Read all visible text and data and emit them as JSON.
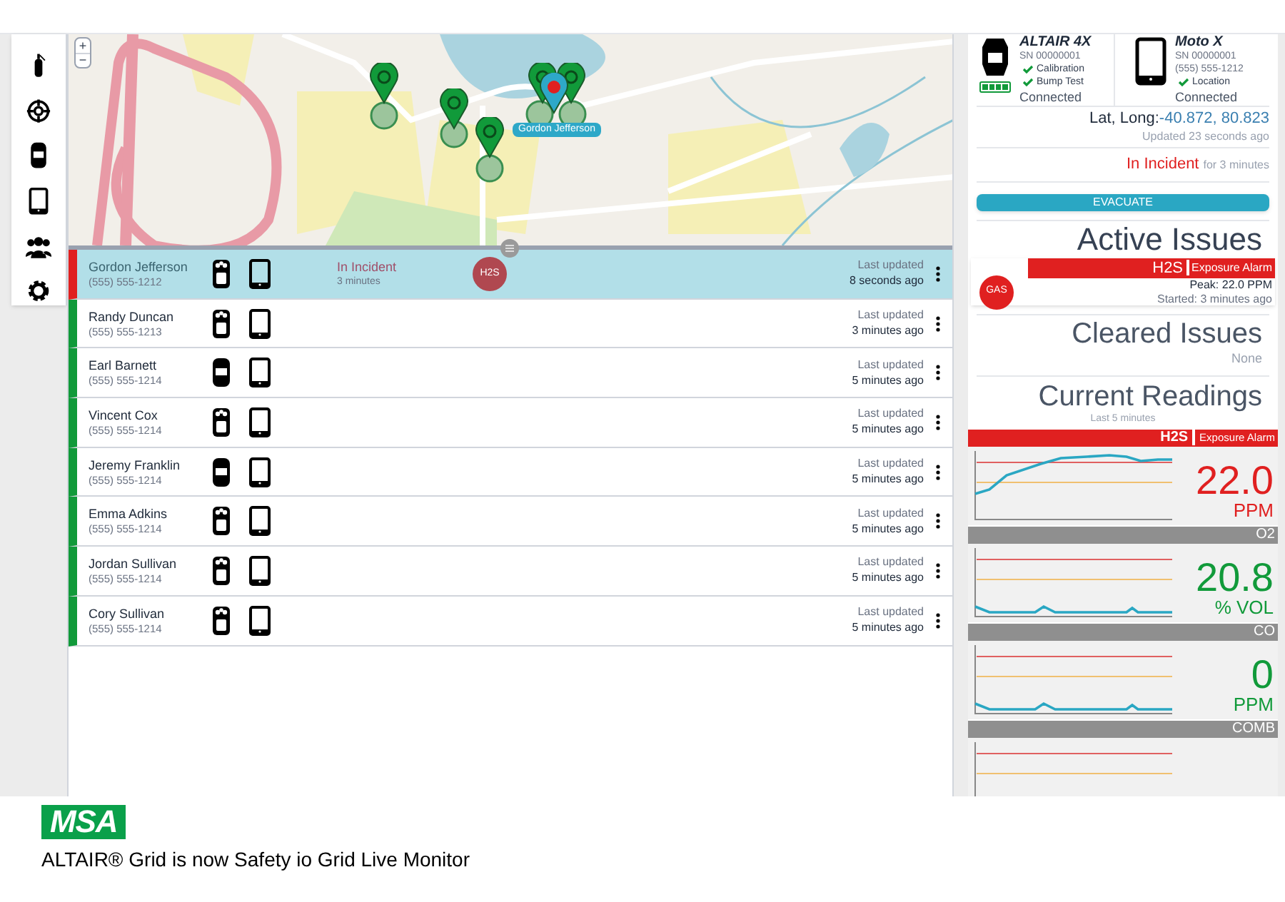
{
  "map": {
    "zoom_in": "+",
    "zoom_out": "−",
    "marker_label": "Gordon Jefferson"
  },
  "workers": [
    {
      "name": "Gordon Jefferson",
      "phone": "(555) 555-1212",
      "color": "#e02020",
      "selected": true,
      "kind": "multi",
      "status": "In Incident",
      "status_time": "3 minutes",
      "badge": "H2S",
      "updated_label": "Last updated",
      "updated": "8 seconds ago"
    },
    {
      "name": "Randy Duncan",
      "phone": "(555) 555-1213",
      "color": "#119a3a",
      "selected": false,
      "kind": "multi",
      "updated_label": "Last updated",
      "updated": "3 minutes ago"
    },
    {
      "name": "Earl Barnett",
      "phone": "(555) 555-1214",
      "color": "#119a3a",
      "selected": false,
      "kind": "single",
      "updated_label": "Last updated",
      "updated": "5 minutes ago"
    },
    {
      "name": "Vincent Cox",
      "phone": "(555) 555-1214",
      "color": "#119a3a",
      "selected": false,
      "kind": "multi",
      "updated_label": "Last updated",
      "updated": "5 minutes ago"
    },
    {
      "name": "Jeremy Franklin",
      "phone": "(555) 555-1214",
      "color": "#119a3a",
      "selected": false,
      "kind": "single",
      "updated_label": "Last updated",
      "updated": "5 minutes ago"
    },
    {
      "name": "Emma Adkins",
      "phone": "(555) 555-1214",
      "color": "#119a3a",
      "selected": false,
      "kind": "multi",
      "updated_label": "Last updated",
      "updated": "5 minutes ago"
    },
    {
      "name": "Jordan Sullivan",
      "phone": "(555) 555-1214",
      "color": "#119a3a",
      "selected": false,
      "kind": "multi",
      "updated_label": "Last updated",
      "updated": "5 minutes ago"
    },
    {
      "name": "Cory Sullivan",
      "phone": "(555) 555-1214",
      "color": "#119a3a",
      "selected": false,
      "kind": "multi",
      "updated_label": "Last updated",
      "updated": "5 minutes ago"
    }
  ],
  "device_panel": {
    "devices": [
      {
        "kind": "detector",
        "model": "ALTAIR 4X",
        "serial": "SN 00000001",
        "checks": [
          "Calibration",
          "Bump Test"
        ],
        "status": "Connected"
      },
      {
        "kind": "phone",
        "model": "Moto X",
        "serial": "SN 00000001",
        "phone": "(555) 555-1212",
        "checks": [
          "Location"
        ],
        "status": "Connected"
      }
    ],
    "location_label": "Lat, Long:",
    "location_value": "-40.872, 80.823",
    "location_updated": "Updated 23 seconds ago",
    "incident_status": "In Incident",
    "incident_duration": "for 3 minutes",
    "action_button": "EVACUATE"
  },
  "active_issues": {
    "title": "Active Issues",
    "items": [
      {
        "badge": "GAS",
        "gas": "H2S",
        "alarm": "Exposure Alarm",
        "peak": "Peak: 22.0 PPM",
        "started": "Started: 3 minutes ago"
      }
    ]
  },
  "cleared_issues": {
    "title": "Cleared Issues",
    "empty": "None"
  },
  "current_readings": {
    "title": "Current Readings",
    "subtitle": "Last 5 minutes",
    "sensors": [
      {
        "gas": "H2S",
        "alarm": "Exposure Alarm",
        "in_alarm": true,
        "value": "22.0",
        "unit": "PPM"
      },
      {
        "gas": "O2",
        "in_alarm": false,
        "value": "20.8",
        "unit": "% VOL"
      },
      {
        "gas": "CO",
        "in_alarm": false,
        "value": "0",
        "unit": "PPM"
      },
      {
        "gas": "COMB",
        "in_alarm": false
      }
    ]
  },
  "footer": {
    "logo": "MSA",
    "caption": "ALTAIR® Grid is now Safety io Grid Live Monitor"
  }
}
